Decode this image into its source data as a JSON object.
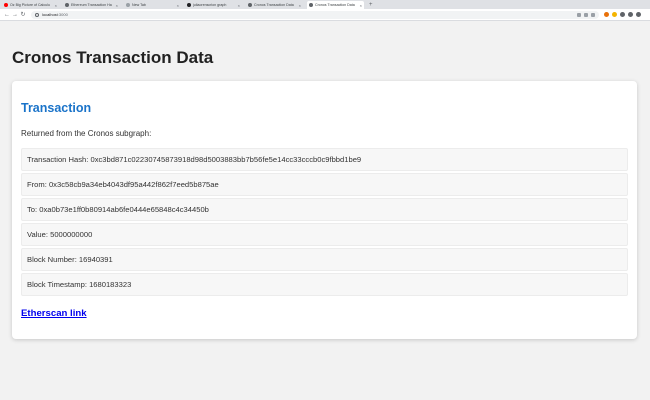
{
  "browser": {
    "tabs": [
      {
        "label": "Oz Big Picture of Calculu",
        "favicon_color": "#ff0000",
        "active": false
      },
      {
        "label": "Ethereum Transaction Ha",
        "favicon_color": "#5f6368",
        "active": false
      },
      {
        "label": "New Tab",
        "favicon_color": "#9aa0a6",
        "active": false
      },
      {
        "label": "juliaorenscrion graph",
        "favicon_color": "#202124",
        "active": false
      },
      {
        "label": "Cronos Transaction Data",
        "favicon_color": "#5f6368",
        "active": false
      },
      {
        "label": "Cronos Transaction Data",
        "favicon_color": "#5f6368",
        "active": true
      }
    ],
    "new_tab_symbol": "+",
    "close_symbol": "×",
    "url_host": "localhost",
    "url_port": ":3000",
    "extension_colors": [
      "#e8710a",
      "#f4b400",
      "#5f6368",
      "#5f6368",
      "#5f6368"
    ]
  },
  "page": {
    "title": "Cronos Transaction Data"
  },
  "card": {
    "title": "Transaction",
    "subtitle": "Returned from the Cronos subgraph:",
    "rows": [
      {
        "key": "Transaction Hash",
        "value": "0xc3bd871c02230745873918d98d5003883bb7b56fe5e14cc33cccb0c9fbbd1be9"
      },
      {
        "key": "From",
        "value": "0x3c58cb9a34eb4043df95a442f862f7eed5b875ae"
      },
      {
        "key": "To",
        "value": "0xa0b73e1ff0b80914ab6fe0444e65848c4c34450b"
      },
      {
        "key": "Value",
        "value": "5000000000"
      },
      {
        "key": "Block Number",
        "value": "16940391"
      },
      {
        "key": "Block Timestamp",
        "value": "1680183323"
      }
    ],
    "link_label": "Etherscan link"
  }
}
